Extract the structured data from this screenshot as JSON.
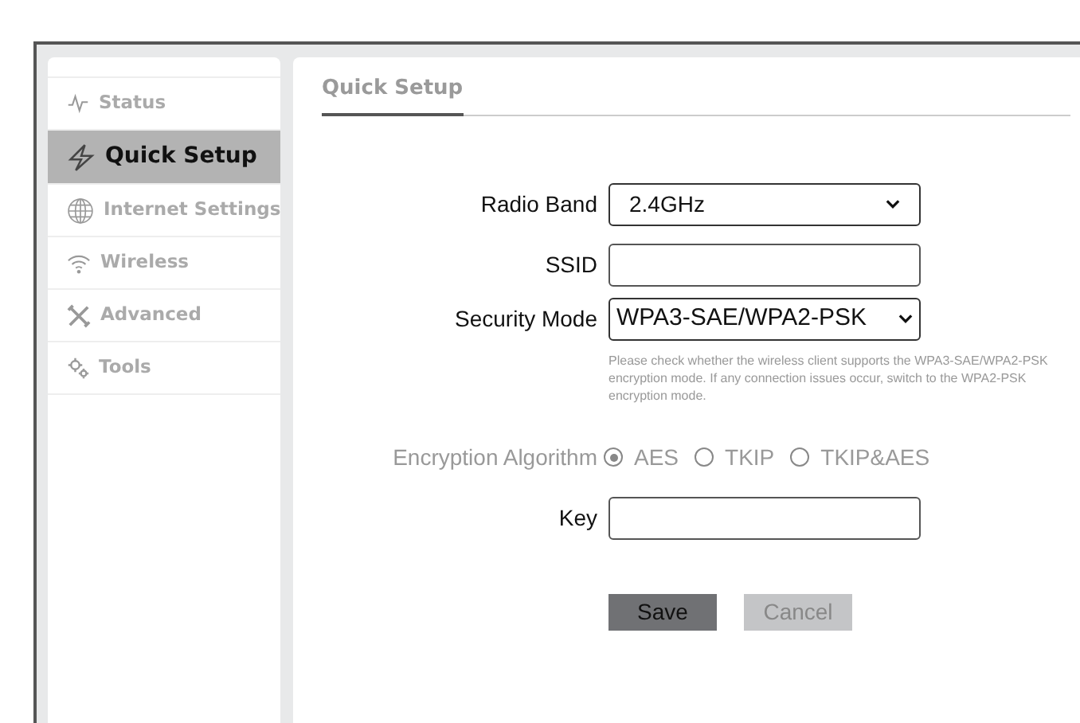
{
  "sidebar": {
    "items": [
      {
        "label": "Status",
        "selected": false
      },
      {
        "label": "Quick Setup",
        "selected": true
      },
      {
        "label": "Internet Settings",
        "selected": false
      },
      {
        "label": "Wireless",
        "selected": false
      },
      {
        "label": "Advanced",
        "selected": false
      },
      {
        "label": "Tools",
        "selected": false
      }
    ]
  },
  "panel": {
    "title": "Quick Setup",
    "radio_band": {
      "label": "Radio Band",
      "value": "2.4GHz"
    },
    "ssid": {
      "label": "SSID"
    },
    "security_mode": {
      "label": "Security Mode",
      "value": "WPA3-SAE/WPA2-PSK",
      "hint": "Please check whether the wireless client supports the WPA3-SAE/WPA2-PSK encryption mode. If any connection issues occur, switch to the WPA2-PSK encryption mode."
    },
    "encryption_algorithm": {
      "label": "Encryption Algorithm",
      "disabled": true,
      "options": [
        {
          "label": "AES",
          "selected": true
        },
        {
          "label": "TKIP",
          "selected": false
        },
        {
          "label": "TKIP&AES",
          "selected": false
        }
      ]
    },
    "key": {
      "label": "Key"
    },
    "buttons": [
      {
        "label": "Save",
        "disabled": false
      },
      {
        "label": "Cancel",
        "disabled": true
      }
    ]
  }
}
